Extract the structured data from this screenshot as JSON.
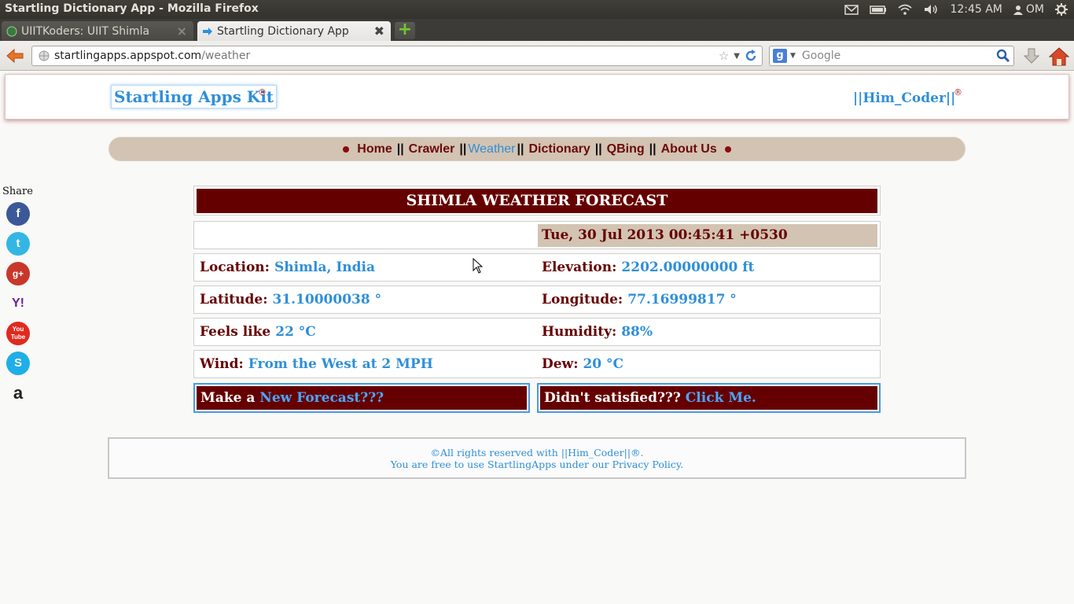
{
  "system": {
    "window_title": "Startling Dictionary App - Mozilla Firefox",
    "clock": "12:45 AM",
    "user": "OM"
  },
  "tabs": [
    {
      "label": "UIITKoders: UIIT Shimla"
    },
    {
      "label": "Startling Dictionary App"
    }
  ],
  "toolbar": {
    "url_host": "startlingapps.appspot.com",
    "url_path": "/weather",
    "search_placeholder": "Google"
  },
  "header": {
    "brand": "Startling Apps Kit",
    "brand_mark": "®",
    "coder": "||Him_Coder||",
    "coder_mark": "®"
  },
  "menu": {
    "items": [
      {
        "label": "Home"
      },
      {
        "label": "Crawler"
      },
      {
        "label": "Weather"
      },
      {
        "label": "Dictionary"
      },
      {
        "label": "QBing"
      },
      {
        "label": "About Us"
      }
    ],
    "separator": "||"
  },
  "share": {
    "label": "Share",
    "services": [
      "facebook",
      "twitter",
      "google-plus",
      "yahoo",
      "youtube",
      "skype",
      "amazon"
    ]
  },
  "forecast": {
    "title": "SHIMLA WEATHER FORECAST",
    "datetime": "Tue, 30 Jul 2013 00:45:41 +0530",
    "location_label": "Location:",
    "location": "Shimla, India",
    "elevation_label": "Elevation:",
    "elevation": "2202.00000000 ft",
    "latitude_label": "Latitude:",
    "latitude": "31.10000038 °",
    "longitude_label": "Longitude:",
    "longitude": "77.16999817 °",
    "feels_label": "Feels like",
    "feels": "22 °C",
    "humidity_label": "Humidity:",
    "humidity": "88%",
    "wind_label": "Wind:",
    "wind": "From the West at 2 MPH",
    "dew_label": "Dew:",
    "dew": "20 °C",
    "new_prefix": "Make a",
    "new_link": "New Forecast???",
    "unsat_prefix": "Didn't satisfied???",
    "unsat_link": "Click Me."
  },
  "footer": {
    "line1": "©All rights reserved with ||Him_Coder||®.",
    "line2": "You are free to use StartlingApps under our Privacy Policy."
  },
  "colors": {
    "maroon": "#650000",
    "link_blue": "#2f8fd8",
    "menu_bg": "#d3c3b2"
  }
}
